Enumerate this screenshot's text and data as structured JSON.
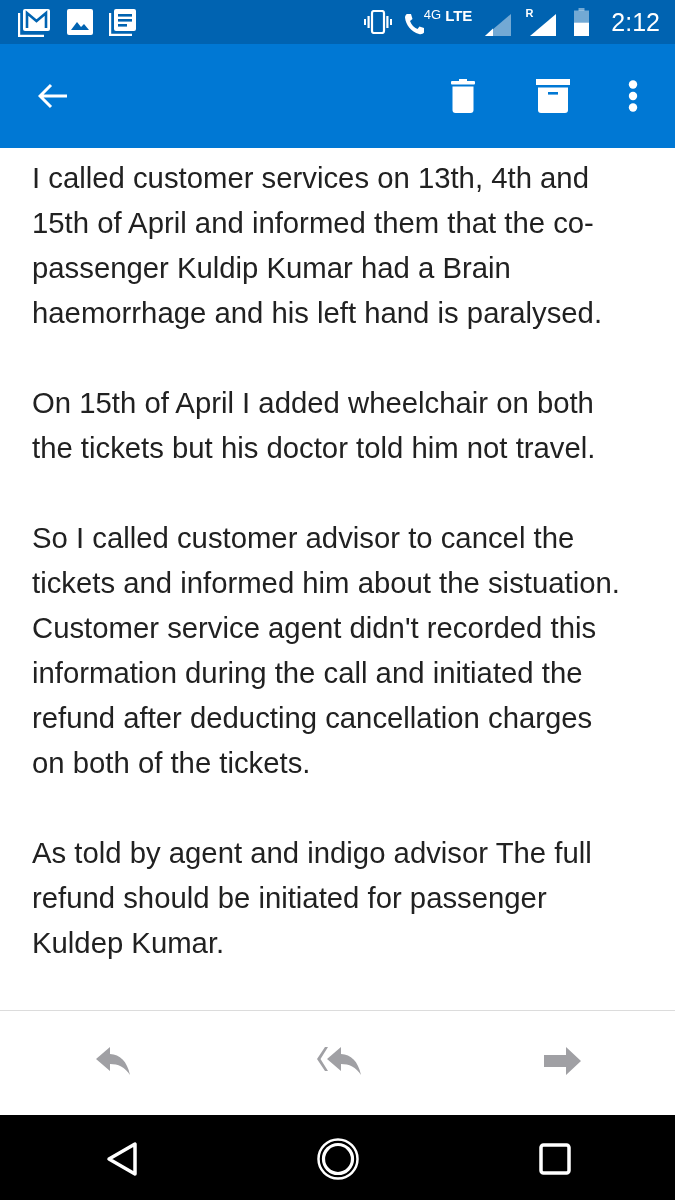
{
  "status_bar": {
    "call_label": "4G",
    "network": "LTE",
    "roaming": "R",
    "time": "2:12"
  },
  "message": {
    "paragraphs": [
      "I called customer services on 13th, 4th and 15th of April and informed them that the co-passenger Kuldip Kumar had a Brain haemorrhage and his left hand is paralysed.",
      "On 15th of April I added wheelchair on both the tickets but his doctor told him not travel.",
      "So I called customer advisor to cancel the tickets and informed him about the sistuation. Customer service agent didn't recorded this information during the call and initiated the refund after deducting cancellation charges on both of the tickets.",
      "As told by agent and indigo advisor The full refund should be initiated for passenger Kuldep Kumar."
    ]
  }
}
